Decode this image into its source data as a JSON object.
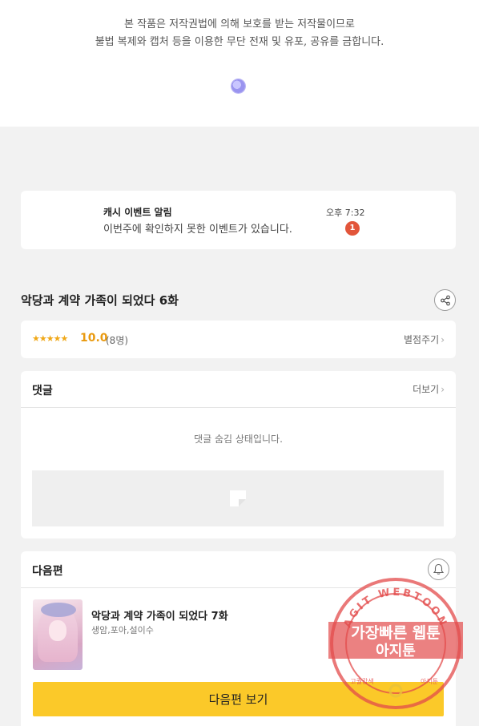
{
  "notice": {
    "line1": "본 작품은 저작권법에 의해 보호를 받는 저작물이므로",
    "line2": "불법 복제와 캡처 등을 이용한 무단 전재 및 유포, 공유를 금합니다."
  },
  "event": {
    "title": "캐시 이벤트 알림",
    "time": "오후 7:32",
    "body": "이번주에 확인하지 못한 이벤트가 있습니다.",
    "badge": "1"
  },
  "episode": {
    "title": "악당과 계약 가족이 되었다 6화"
  },
  "rating": {
    "stars": "★★★★★",
    "score": "10.0",
    "count": "(8명)",
    "rate_link": "별점주기"
  },
  "comments": {
    "title": "댓글",
    "more": "더보기",
    "hidden_msg": "댓글 숨김 상태입니다."
  },
  "next": {
    "title": "다음편",
    "episode_title": "악당과 계약 가족이 되었다 7화",
    "authors": "생암,포아,설이수",
    "button": "다음편 보기"
  },
  "watermark": {
    "ring_text": "AGIT WEBTOON",
    "line1": "가장빠른 웹툰",
    "line2": "아지툰",
    "bottom_left": "고퀄감색",
    "bottom_right": "아지툰"
  },
  "icons": {
    "share": "share-icon",
    "bell": "bell-icon",
    "ad": "image-placeholder-icon",
    "loading": "loading-dot-icon"
  },
  "colors": {
    "accent_yellow": "#fbc929",
    "star_orange": "#f0a818",
    "badge_red": "#e2553a",
    "watermark_red": "#e34b4b"
  }
}
